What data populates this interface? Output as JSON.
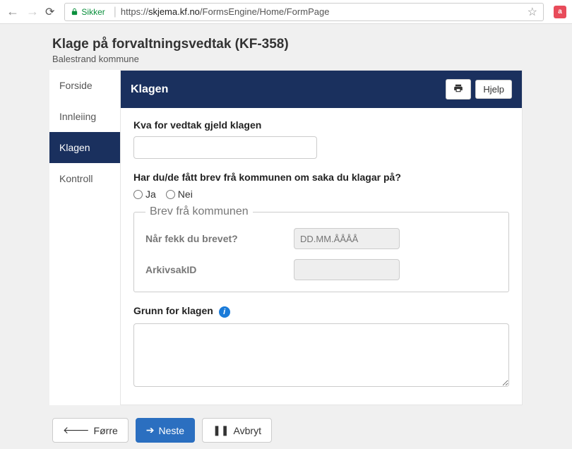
{
  "browser": {
    "secure_label": "Sikker",
    "url_prefix": "https://",
    "url_host": "skjema.kf.no",
    "url_path": "/FormsEngine/Home/FormPage"
  },
  "header": {
    "title": "Klage på forvaltningsvedtak (KF-358)",
    "subtitle": "Balestrand kommune"
  },
  "sidebar": {
    "items": [
      {
        "label": "Forside"
      },
      {
        "label": "Innleiing"
      },
      {
        "label": "Klagen"
      },
      {
        "label": "Kontroll"
      }
    ],
    "active_index": 2
  },
  "panel": {
    "title": "Klagen",
    "help_label": "Hjelp"
  },
  "form": {
    "q_vedtak_label": "Kva for vedtak gjeld klagen",
    "q_vedtak_value": "",
    "q_brev_label": "Har du/de fått brev frå kommunen om saka du klagar på?",
    "radio_yes": "Ja",
    "radio_no": "Nei",
    "fieldset_legend": "Brev frå kommunen",
    "q_naar_label": "Når fekk du brevet?",
    "q_naar_placeholder": "DD.MM.ÅÅÅÅ",
    "q_arkiv_label": "ArkivsakID",
    "q_grunn_label": "Grunn for klagen"
  },
  "footer": {
    "prev": "Førre",
    "next": "Neste",
    "cancel": "Avbryt"
  }
}
